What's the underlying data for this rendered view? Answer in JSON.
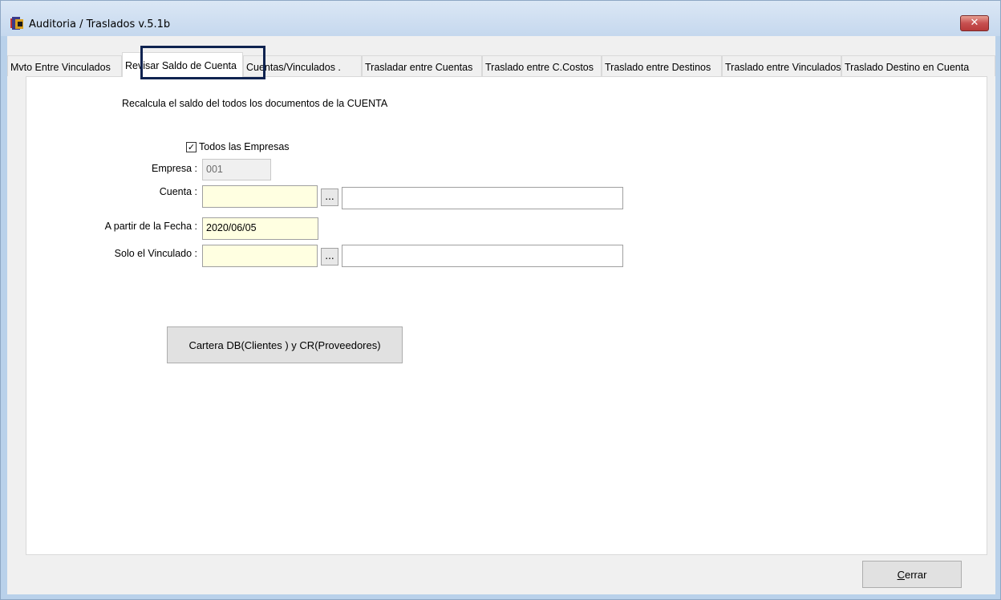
{
  "window": {
    "title": "Auditoria / Traslados  v.5.1b",
    "close_label": "✕"
  },
  "tabs": [
    {
      "label": "Mvto Entre Vinculados"
    },
    {
      "label": "Revisar Saldo de Cuenta"
    },
    {
      "label": "Cuentas/Vinculados ."
    },
    {
      "label": "Trasladar entre Cuentas"
    },
    {
      "label": "Traslado entre C.Costos"
    },
    {
      "label": "Traslado entre Destinos"
    },
    {
      "label": "Traslado entre Vinculados"
    },
    {
      "label": "Traslado Destino en Cuenta"
    }
  ],
  "active_tab_index": 1,
  "form": {
    "description": "Recalcula el saldo del todos los documentos de la CUENTA",
    "todas_empresas_label": "Todos las Empresas",
    "todas_empresas_checked": true,
    "empresa_label": "Empresa :",
    "empresa_value": "001",
    "cuenta_label": "Cuenta :",
    "cuenta_value": "",
    "cuenta_name_value": "",
    "fecha_label": "A partir de la Fecha :",
    "fecha_value": "2020/06/05",
    "vinculado_label": "Solo el  Vinculado :",
    "vinculado_value": "",
    "vinculado_name_value": "",
    "lookup_button_label": "...",
    "cartera_button_label": "Cartera DB(Clientes ) y CR(Proveedores)"
  },
  "footer": {
    "cerrar_first_letter": "C",
    "cerrar_rest": "errar"
  },
  "colors": {
    "input_yellow": "#ffffe1",
    "highlight_border": "#0f2350"
  }
}
